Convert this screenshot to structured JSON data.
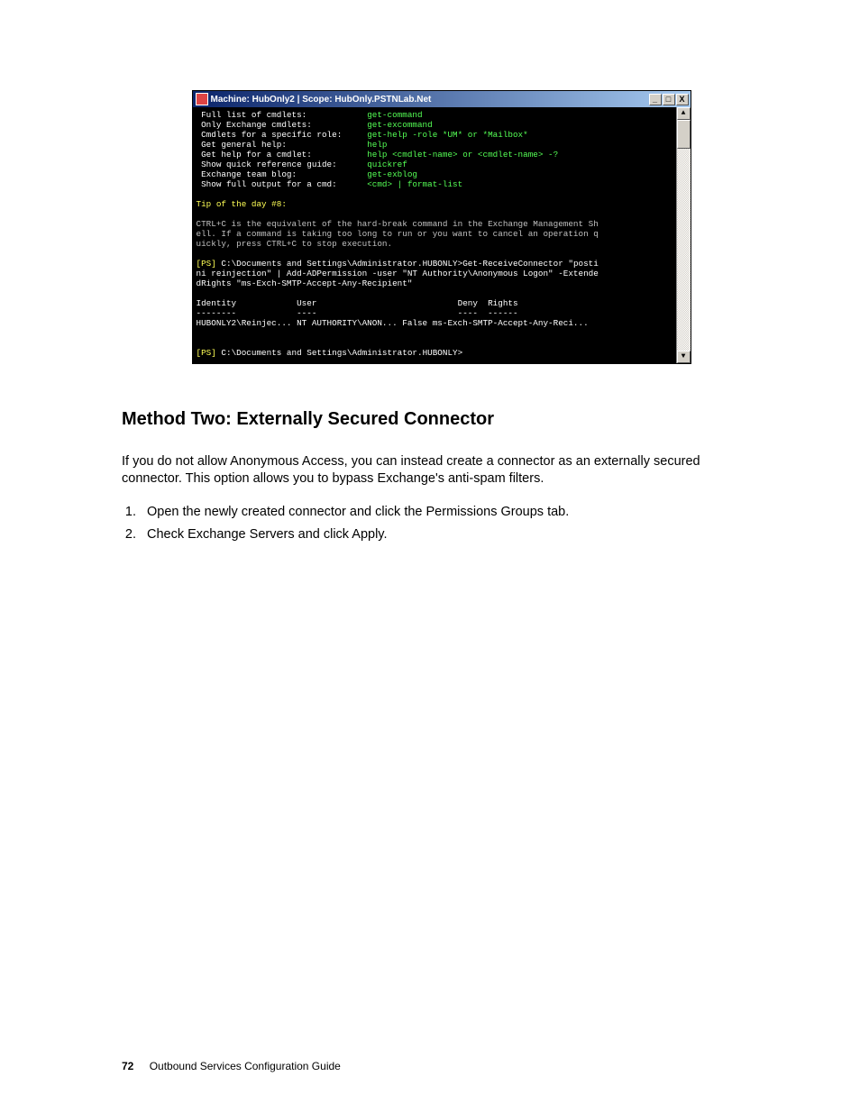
{
  "console": {
    "title": "Machine: HubOnly2 | Scope: HubOnly.PSTNLab.Net",
    "controls": {
      "min": "_",
      "max": "□",
      "close": "X"
    },
    "scroll": {
      "up": "▲",
      "down": "▼"
    },
    "help_left": [
      " Full list of cmdlets:",
      " Only Exchange cmdlets:",
      " Cmdlets for a specific role:",
      " Get general help:",
      " Get help for a cmdlet:",
      " Show quick reference guide:",
      " Exchange team blog:",
      " Show full output for a cmd:"
    ],
    "help_right": [
      "get-command",
      "get-excommand",
      "get-help -role *UM* or *Mailbox*",
      "help",
      "help <cmdlet-name> or <cmdlet-name> -?",
      "quickref",
      "get-exblog",
      "<cmd> | format-list"
    ],
    "tip_header": "Tip of the day #8:",
    "tip_body": [
      "CTRL+C is the equivalent of the hard-break command in the Exchange Management Sh",
      "ell. If a command is taking too long to run or you want to cancel an operation q",
      "uickly, press CTRL+C to stop execution."
    ],
    "cmd_lines": [
      "[PS] C:\\Documents and Settings\\Administrator.HUBONLY>Get-ReceiveConnector \"posti",
      "ni reinjection\" | Add-ADPermission -user \"NT Authority\\Anonymous Logon\" -Extende",
      "dRights \"ms-Exch-SMTP-Accept-Any-Recipient\""
    ],
    "cmd_prefix": "[PS] ",
    "table_header": "Identity            User                            Deny  Rights",
    "table_underl": "--------            ----                            ----  ------",
    "table_row": "HUBONLY2\\Reinjec... NT AUTHORITY\\ANON... False ms-Exch-SMTP-Accept-Any-Reci...",
    "prompt_end": "[PS] C:\\Documents and Settings\\Administrator.HUBONLY>"
  },
  "heading": "Method Two: Externally Secured Connector",
  "paragraph": "If you do not allow Anonymous Access, you can instead create a connector as an externally secured connector. This option allows you to bypass Exchange's anti-spam filters.",
  "steps": [
    "Open the newly created connector and click the Permissions Groups tab.",
    "Check Exchange Servers and click Apply."
  ],
  "footer": {
    "page": "72",
    "title": "Outbound Services Configuration Guide"
  }
}
